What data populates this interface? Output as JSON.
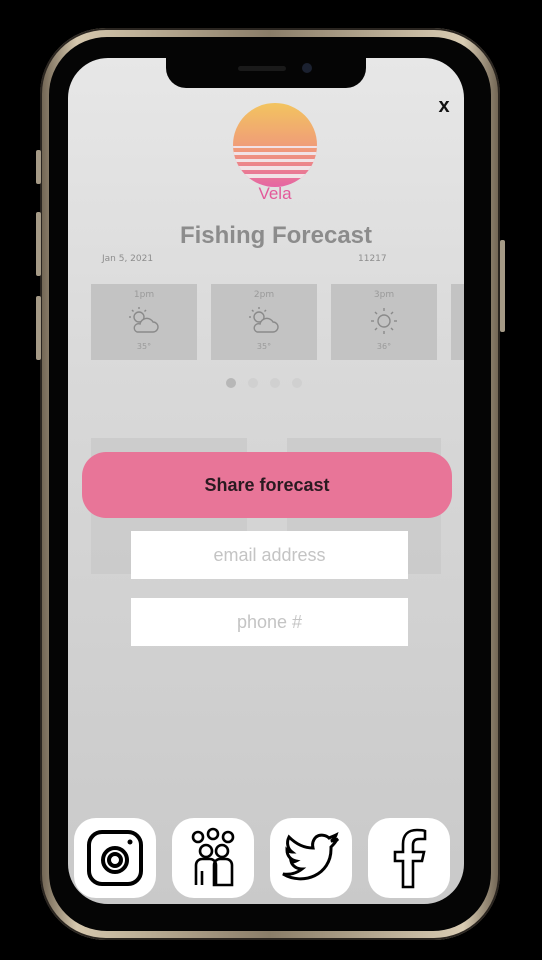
{
  "app": {
    "brand": "Vela",
    "close_label": "x"
  },
  "forecast": {
    "title": "Fishing Forecast",
    "date": "Jan 5, 2021",
    "ref": "11217",
    "hours": [
      {
        "time": "1pm",
        "icon": "partly-cloudy-icon",
        "temp": "35°"
      },
      {
        "time": "2pm",
        "icon": "partly-cloudy-icon",
        "temp": "35°"
      },
      {
        "time": "3pm",
        "icon": "sun-icon",
        "temp": "36°"
      }
    ],
    "pagination": {
      "count": 4,
      "active": 1
    }
  },
  "share": {
    "button_label": "Share forecast",
    "email_placeholder": "email address",
    "phone_placeholder": "phone #"
  },
  "social": [
    {
      "name": "instagram-icon"
    },
    {
      "name": "group-icon"
    },
    {
      "name": "twitter-icon"
    },
    {
      "name": "facebook-icon"
    }
  ],
  "colors": {
    "brand": "#e35a9a",
    "share_button": "#e87598",
    "sun_top": "#f2c45f",
    "sun_bottom": "#e565a4"
  }
}
